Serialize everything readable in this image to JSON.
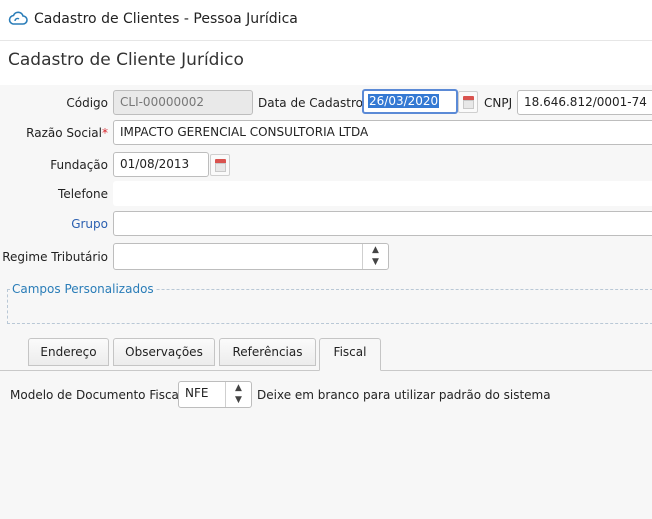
{
  "window": {
    "title": "Cadastro de Clientes - Pessoa Jurídica"
  },
  "page": {
    "heading": "Cadastro de Cliente Jurídico"
  },
  "form": {
    "codigo": {
      "label": "Código",
      "value": "CLI-00000002"
    },
    "data_cadastro": {
      "label": "Data de Cadastro",
      "value": "26/03/2020"
    },
    "cnpj": {
      "label": "CNPJ",
      "value": "18.646.812/0001-74"
    },
    "razao_social": {
      "label": "Razão Social",
      "required_mark": "*",
      "value": "IMPACTO GERENCIAL CONSULTORIA LTDA"
    },
    "fundacao": {
      "label": "Fundação",
      "value": "01/08/2013"
    },
    "telefone": {
      "label": "Telefone",
      "value": ""
    },
    "grupo": {
      "label": "Grupo",
      "value": ""
    },
    "regime_tributario": {
      "label": "Regime Tributário",
      "value": ""
    }
  },
  "custom_fields": {
    "legend": "Campos Personalizados"
  },
  "tabs": [
    {
      "label": "Endereço",
      "active": false
    },
    {
      "label": "Observações",
      "active": false
    },
    {
      "label": "Referências",
      "active": false
    },
    {
      "label": "Fiscal",
      "active": true
    }
  ],
  "fiscal": {
    "modelo_label": "Modelo de Documento Fiscal",
    "modelo_value": "NFE",
    "hint": "Deixe em branco para utilizar padrão do sistema"
  },
  "icons": {
    "spinner_up": "▲",
    "spinner_down": "▼"
  },
  "colors": {
    "accent": "#2a5fb0",
    "required": "#d9262c",
    "selection": "#3479d3",
    "calendar": "#d9534f"
  }
}
